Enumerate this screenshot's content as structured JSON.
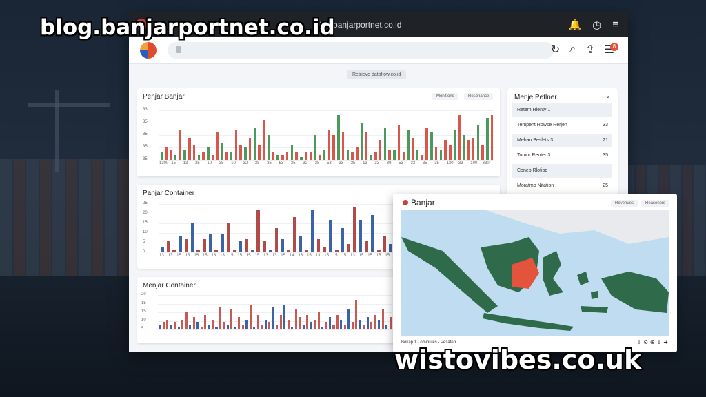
{
  "watermarks": {
    "top": "blog.banjarportnet.co.id",
    "bottom": "wistovibes.co.uk"
  },
  "browser": {
    "title_url": "blog.banjarportnet.co.id",
    "pill_text": "Retrieve dataflow.co.id"
  },
  "chart1": {
    "title": "Penjar Banjar",
    "buttons": [
      "Monitions",
      "Resonance"
    ],
    "yticks": [
      "33",
      "35",
      "35",
      "35",
      "35"
    ],
    "xticks": [
      "1300",
      "15",
      "13",
      "25",
      "10",
      "35",
      "10",
      "32",
      "38",
      "35",
      "53",
      "35",
      "32",
      "38",
      "53",
      "33",
      "35",
      "13",
      "33",
      "39",
      "53",
      "33",
      "35",
      "35",
      "130",
      "33",
      "100",
      "330"
    ],
    "chart_data": {
      "type": "bar",
      "colors": [
        "#d9574a",
        "#4a9a5c"
      ],
      "values": [
        3,
        5,
        4,
        2,
        12,
        4,
        9,
        6,
        2,
        3,
        5,
        2,
        11,
        7,
        3,
        3,
        12,
        6,
        5,
        9,
        13,
        6,
        16,
        10,
        3,
        2,
        2,
        3,
        6,
        3,
        1,
        3,
        3,
        10,
        2,
        4,
        12,
        10,
        18,
        11,
        4,
        3,
        5,
        15,
        11,
        2,
        3,
        8,
        13,
        4,
        4,
        14,
        3,
        12,
        9,
        4,
        2,
        13,
        11,
        5,
        4,
        8,
        6,
        12,
        18,
        10,
        8,
        9,
        14,
        6,
        17,
        18
      ]
    }
  },
  "chart2": {
    "title": "Panjar Container",
    "yticks": [
      "25",
      "20",
      "15",
      "10",
      "5",
      "0"
    ],
    "xticks": [
      "13",
      "13",
      "15",
      "13",
      "15",
      "15",
      "18",
      "13",
      "15",
      "15",
      "15",
      "15",
      "13",
      "13",
      "15",
      "14",
      "13",
      "15",
      "13",
      "15",
      "15",
      "15",
      "13",
      "15",
      "15",
      "15",
      "15"
    ],
    "chart_data": {
      "type": "bar",
      "colors": [
        "#b24a4a",
        "#3b63a8"
      ],
      "values": [
        2,
        4,
        1,
        6,
        5,
        11,
        1,
        5,
        7,
        1,
        7,
        11,
        1,
        4,
        5,
        1,
        16,
        4,
        1,
        9,
        5,
        1,
        13,
        6,
        1,
        16,
        5,
        2,
        12,
        1,
        9,
        3,
        17,
        12,
        4,
        14,
        1,
        6,
        3
      ]
    }
  },
  "chart3": {
    "title": "Menjar Container",
    "yticks": [
      "20",
      "15",
      "15",
      "10",
      "5"
    ],
    "chart_data": {
      "type": "bar",
      "colors": [
        "#c75a52",
        "#3b63a8"
      ],
      "values": [
        2,
        3,
        4,
        2,
        3,
        1,
        4,
        7,
        2,
        5,
        3,
        1,
        6,
        2,
        4,
        1,
        9,
        3,
        2,
        8,
        1,
        5,
        2,
        4,
        10,
        1,
        6,
        2,
        4,
        3,
        9,
        2,
        6,
        10,
        4,
        1,
        8,
        5,
        2,
        6,
        3,
        4,
        7,
        1,
        3,
        5,
        2,
        6,
        4,
        2,
        8,
        3,
        12,
        4,
        2,
        5,
        3,
        6,
        4,
        8,
        2,
        5
      ]
    }
  },
  "sidebar": {
    "title": "Menje Petlner",
    "rows": [
      {
        "label": "Retem Rlenty 1",
        "value": ""
      },
      {
        "label": "Tempent Rowse Rerjen",
        "value": "33"
      },
      {
        "label": "Mehan Beslets 3",
        "value": "21"
      },
      {
        "label": "Tomor Renter 3",
        "value": "35"
      },
      {
        "label": "Conep Rlotiod",
        "value": ""
      },
      {
        "label": "Moratmo Nitation",
        "value": "25"
      }
    ]
  },
  "map": {
    "title": "Banjar",
    "buttons": [
      "Revenues",
      "Reaseners"
    ],
    "footer": "Bokap 1 - ominutes - Pesaterr",
    "colors": {
      "sea": "#bfdcf0",
      "land": "#2f6b4a",
      "highlight": "#e4533b",
      "neighbor": "#e8eaed"
    }
  }
}
